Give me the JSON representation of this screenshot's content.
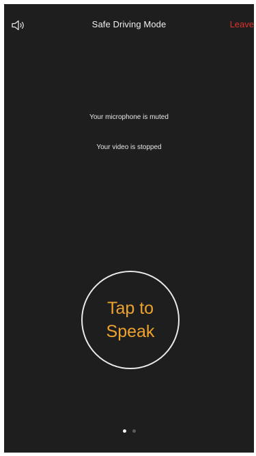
{
  "header": {
    "speaker_icon": "speaker-icon",
    "title": "Safe Driving Mode",
    "leave_label": "Leave"
  },
  "status": {
    "microphone": "Your microphone is muted",
    "video": "Your video is stopped"
  },
  "speak_button": {
    "label": "Tap to\nSpeak"
  },
  "pager": {
    "pages": 2,
    "current_page": 1
  },
  "colors": {
    "background": "#1e1e1e",
    "leave": "#e0312b",
    "accent": "#eda32d",
    "text": "#f0f0f0"
  }
}
